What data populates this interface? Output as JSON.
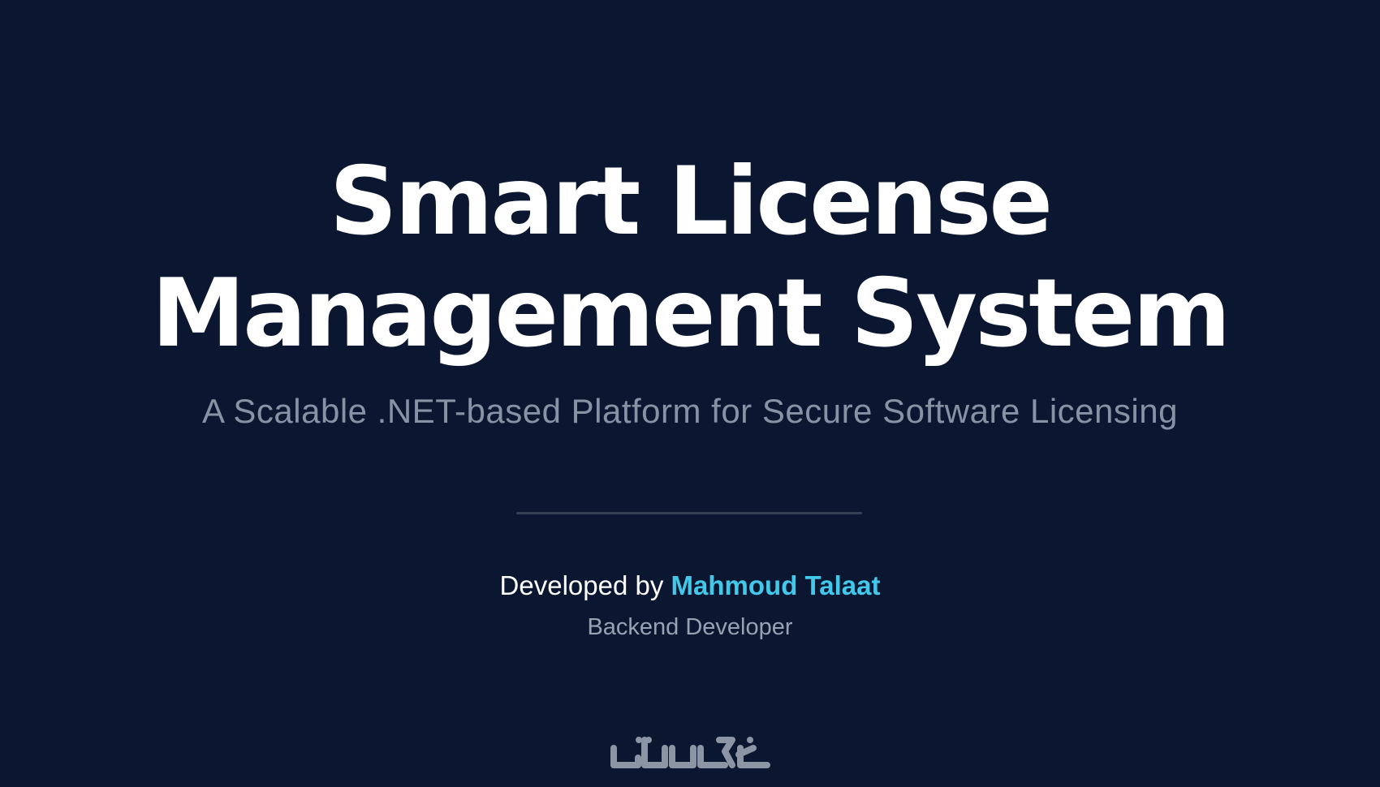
{
  "hero": {
    "title_line_1": "Smart License",
    "title_line_2": "Management System",
    "subtitle": "A Scalable .NET-based Platform for Secure Software Licensing"
  },
  "credit": {
    "prefix": "Developed by ",
    "developer_name": "Mahmoud Talaat",
    "role": "Backend Developer"
  },
  "watermark": {
    "text": "خمسات",
    "icon_name": "khamsat-watermark-icon",
    "color": "#dce3ea"
  },
  "colors": {
    "background": "#0b1730",
    "title": "#ffffff",
    "subtitle": "#8793a4",
    "accent": "#42c8ea",
    "divider": "#344155"
  }
}
